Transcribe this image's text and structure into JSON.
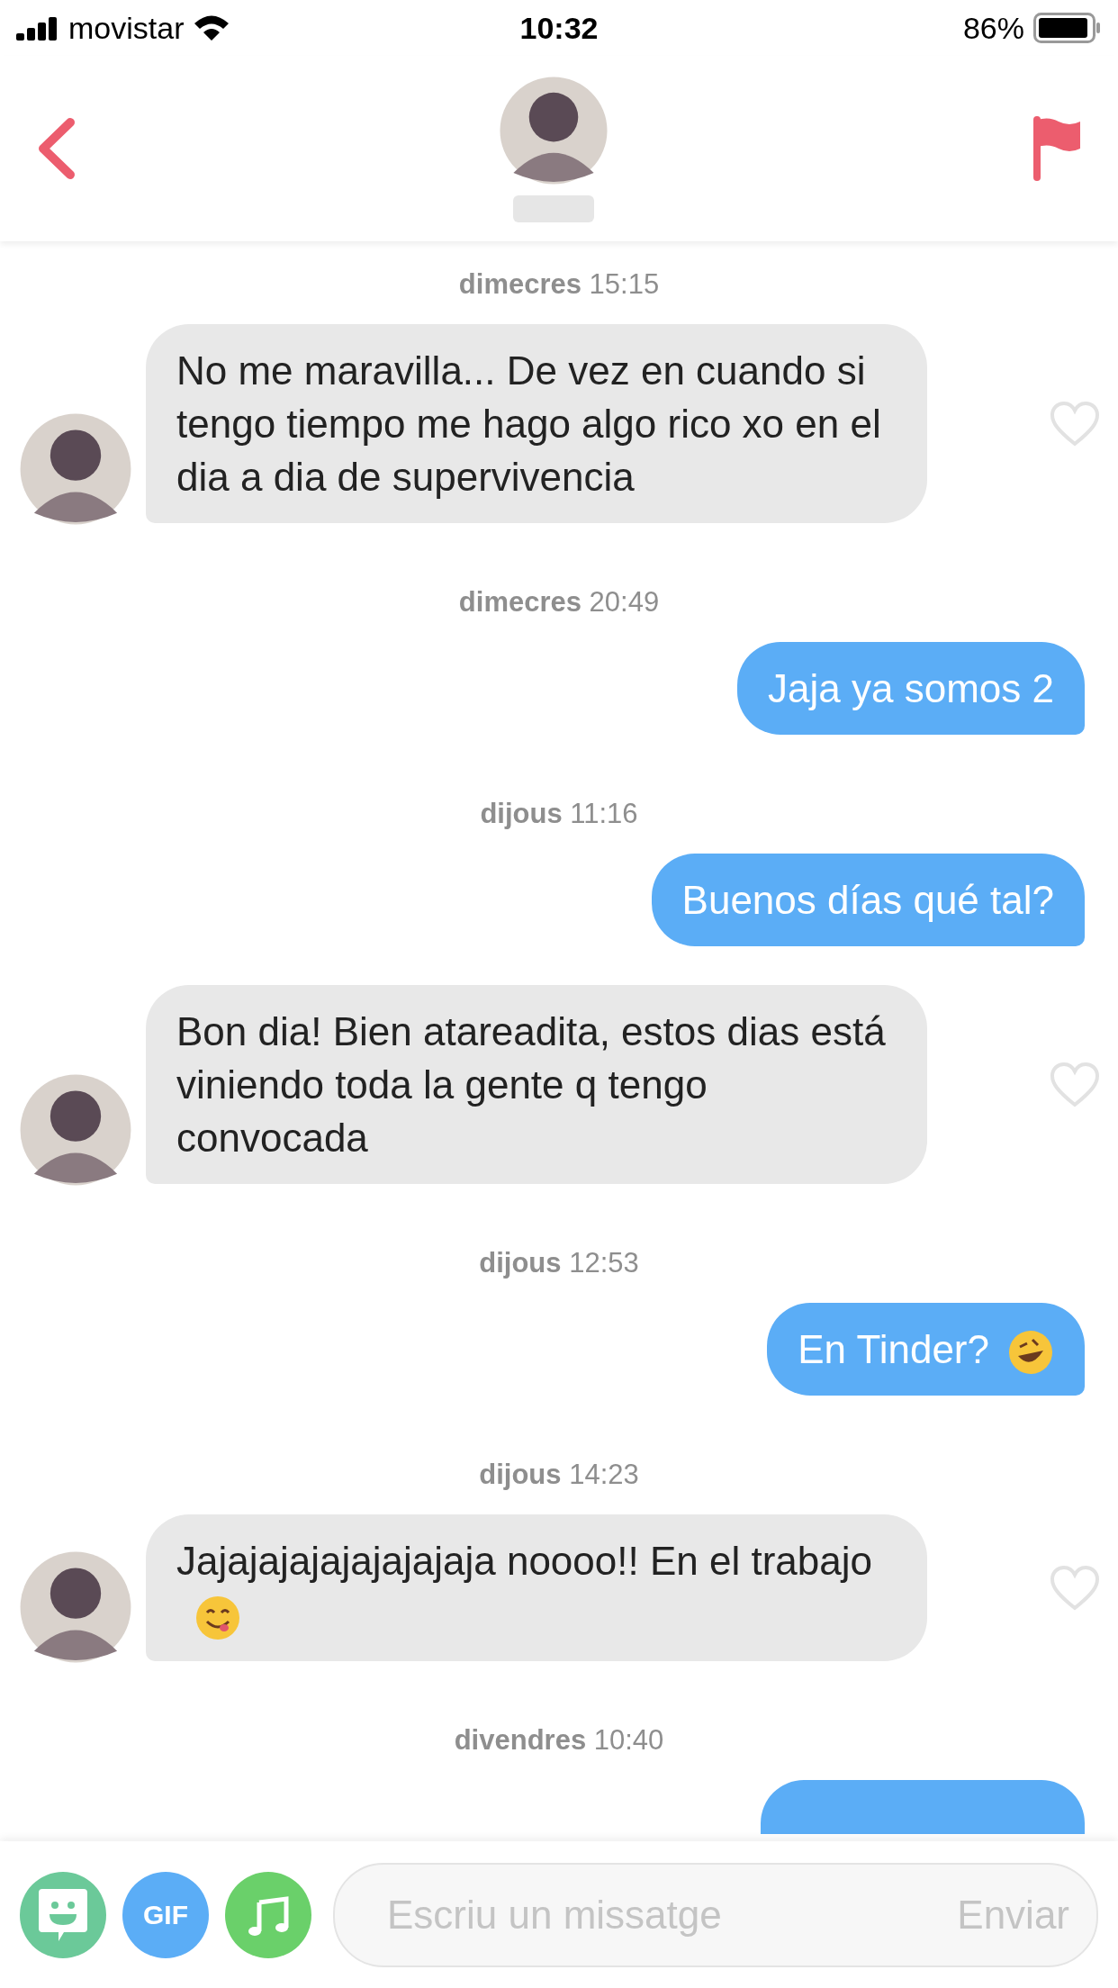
{
  "status_bar": {
    "carrier": "movistar",
    "time": "10:32",
    "battery": "86%"
  },
  "messages": [
    {
      "kind": "timestamp",
      "day": "dimecres",
      "time": "15:15"
    },
    {
      "kind": "received",
      "text": "No me maravilla... De vez en cuando si tengo tiempo me hago algo rico xo en el dia a dia de supervivencia",
      "liked": false
    },
    {
      "kind": "timestamp",
      "day": "dimecres",
      "time": "20:49"
    },
    {
      "kind": "sent",
      "text": "Jaja ya somos 2"
    },
    {
      "kind": "timestamp",
      "day": "dijous",
      "time": "11:16"
    },
    {
      "kind": "sent",
      "text": "Buenos días qué tal?"
    },
    {
      "kind": "received",
      "text": "Bon dia! Bien atareadita, estos dias está viniendo toda la gente q tengo convocada",
      "liked": false
    },
    {
      "kind": "timestamp",
      "day": "dijous",
      "time": "12:53"
    },
    {
      "kind": "sent",
      "text": "En Tinder?",
      "has_emoji": true
    },
    {
      "kind": "timestamp",
      "day": "dijous",
      "time": "14:23"
    },
    {
      "kind": "received",
      "text": "Jajajajajajajajajaja noooo!! En el trabajo",
      "has_emoji": true,
      "liked": false
    },
    {
      "kind": "timestamp",
      "day": "divendres",
      "time": "10:40"
    },
    {
      "kind": "sent_cut"
    }
  ],
  "composer": {
    "placeholder": "Escriu un missatge",
    "send": "Enviar",
    "gif": "GIF"
  }
}
